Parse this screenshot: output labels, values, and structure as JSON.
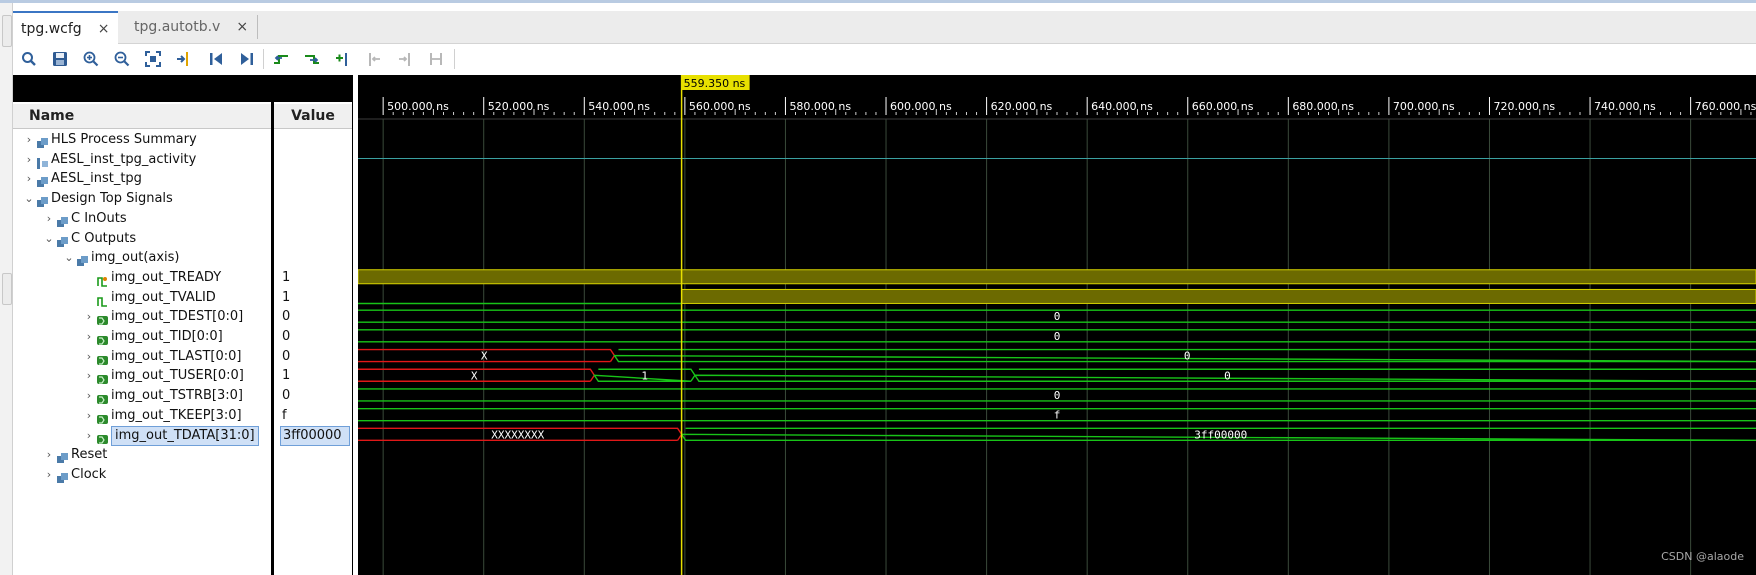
{
  "tabs": [
    {
      "label": "tpg.wcfg",
      "active": true
    },
    {
      "label": "tpg.autotb.v",
      "active": false
    }
  ],
  "tab_close_glyph": "×",
  "toolbar": [
    {
      "name": "search-icon",
      "enabled": true
    },
    {
      "name": "save-icon",
      "enabled": true
    },
    {
      "name": "zoom-in-icon",
      "enabled": true
    },
    {
      "name": "zoom-out-icon",
      "enabled": true
    },
    {
      "name": "zoom-fit-icon",
      "enabled": true
    },
    {
      "name": "go-to-cursor-icon",
      "enabled": true
    },
    {
      "name": "go-to-time-zero-icon",
      "enabled": true
    },
    {
      "name": "go-to-last-time-icon",
      "enabled": true
    },
    {
      "name": "previous-transition-icon",
      "enabled": true
    },
    {
      "name": "next-transition-icon",
      "enabled": true
    },
    {
      "name": "add-marker-icon",
      "enabled": true
    },
    {
      "name": "previous-marker-icon",
      "enabled": false
    },
    {
      "name": "next-marker-icon",
      "enabled": false
    },
    {
      "name": "swap-cursors-icon",
      "enabled": false
    }
  ],
  "columns": {
    "name": "Name",
    "value": "Value"
  },
  "signals": [
    {
      "name": "HLS Process Summary",
      "value": "",
      "indent": 0,
      "expander": "collapsed",
      "icon": "group-icon",
      "kind": "none"
    },
    {
      "name": "AESL_inst_tpg_activity",
      "value": "",
      "indent": 0,
      "expander": "collapsed",
      "icon": "activity-icon",
      "kind": "line"
    },
    {
      "name": "AESL_inst_tpg",
      "value": "",
      "indent": 0,
      "expander": "collapsed",
      "icon": "group-icon",
      "kind": "none"
    },
    {
      "name": "Design Top Signals",
      "value": "",
      "indent": 0,
      "expander": "expanded",
      "icon": "group-icon",
      "kind": "none"
    },
    {
      "name": "C InOuts",
      "value": "",
      "indent": 1,
      "expander": "collapsed",
      "icon": "group-icon",
      "kind": "none"
    },
    {
      "name": "C Outputs",
      "value": "",
      "indent": 1,
      "expander": "expanded",
      "icon": "group-icon",
      "kind": "none"
    },
    {
      "name": "img_out(axis)",
      "value": "",
      "indent": 2,
      "expander": "expanded",
      "icon": "group-icon",
      "kind": "none"
    },
    {
      "name": "img_out_TREADY",
      "value": "1",
      "indent": 3,
      "expander": "none",
      "icon": "input-bit-icon",
      "kind": "bit-high"
    },
    {
      "name": "img_out_TVALID",
      "value": "1",
      "indent": 3,
      "expander": "none",
      "icon": "output-bit-icon",
      "kind": "bit-rise"
    },
    {
      "name": "img_out_TDEST[0:0]",
      "value": "0",
      "indent": 3,
      "expander": "collapsed",
      "icon": "bus-icon",
      "kind": "bus"
    },
    {
      "name": "img_out_TID[0:0]",
      "value": "0",
      "indent": 3,
      "expander": "collapsed",
      "icon": "bus-icon",
      "kind": "bus"
    },
    {
      "name": "img_out_TLAST[0:0]",
      "value": "0",
      "indent": 3,
      "expander": "collapsed",
      "icon": "bus-icon",
      "kind": "bus"
    },
    {
      "name": "img_out_TUSER[0:0]",
      "value": "1",
      "indent": 3,
      "expander": "collapsed",
      "icon": "bus-icon",
      "kind": "bus"
    },
    {
      "name": "img_out_TSTRB[3:0]",
      "value": "0",
      "indent": 3,
      "expander": "collapsed",
      "icon": "bus-icon",
      "kind": "bus"
    },
    {
      "name": "img_out_TKEEP[3:0]",
      "value": "f",
      "indent": 3,
      "expander": "collapsed",
      "icon": "bus-icon",
      "kind": "bus"
    },
    {
      "name": "img_out_TDATA[31:0]",
      "value": "3ff00000",
      "indent": 3,
      "expander": "collapsed",
      "icon": "bus-icon",
      "kind": "bus",
      "selected": true
    },
    {
      "name": "Reset",
      "value": "",
      "indent": 1,
      "expander": "collapsed",
      "icon": "group-icon",
      "kind": "none"
    },
    {
      "name": "Clock",
      "value": "",
      "indent": 1,
      "expander": "collapsed",
      "icon": "group-icon",
      "kind": "none"
    }
  ],
  "timeline": {
    "unit": "ns",
    "tick_labels": [
      "500.000 ns",
      "520.000 ns",
      "540.000 ns",
      "560.000 ns",
      "580.000 ns",
      "600.000 ns",
      "620.000 ns",
      "640.000 ns",
      "660.000 ns",
      "680.000 ns",
      "700.000 ns",
      "720.000 ns",
      "740.000 ns",
      "760.000 ns"
    ],
    "tick_values": [
      500,
      520,
      540,
      560,
      580,
      600,
      620,
      640,
      660,
      680,
      700,
      720,
      740,
      760
    ],
    "view_start": 495,
    "view_end": 773,
    "cursor_time": 559.35,
    "cursor_label": "559.350 ns"
  },
  "waves": {
    "img_out_TDEST[0:0]": [
      {
        "from": 495,
        "to": 773,
        "label": "0",
        "state": "valid"
      }
    ],
    "img_out_TID[0:0]": [
      {
        "from": 495,
        "to": 773,
        "label": "0",
        "state": "valid"
      }
    ],
    "img_out_TLAST[0:0]": [
      {
        "from": 495,
        "to": 546,
        "label": "X",
        "state": "unknown"
      },
      {
        "from": 546,
        "to": 773,
        "label": "0",
        "state": "valid"
      }
    ],
    "img_out_TUSER[0:0]": [
      {
        "from": 495,
        "to": 542,
        "label": "X",
        "state": "unknown"
      },
      {
        "from": 542,
        "to": 562,
        "label": "1",
        "state": "valid"
      },
      {
        "from": 562,
        "to": 773,
        "label": "0",
        "state": "valid"
      }
    ],
    "img_out_TSTRB[3:0]": [
      {
        "from": 495,
        "to": 773,
        "label": "0",
        "state": "valid"
      }
    ],
    "img_out_TKEEP[3:0]": [
      {
        "from": 495,
        "to": 773,
        "label": "f",
        "state": "valid"
      }
    ],
    "img_out_TDATA[31:0]": [
      {
        "from": 495,
        "to": 559.35,
        "label": "XXXXXXXX",
        "state": "unknown"
      },
      {
        "from": 559.35,
        "to": 773,
        "label": "3ff00000",
        "state": "valid"
      }
    ],
    "img_out_TREADY": {
      "high_from": 495
    },
    "img_out_TVALID": {
      "high_from": 559.35
    }
  },
  "colors": {
    "wave_bg": "#000000",
    "grid": "#3a4a3a",
    "bus_valid": "#18c418",
    "bus_unknown": "#e01818",
    "bit_high": "#6c6a00",
    "bit_edge": "#d6d200",
    "cursor": "#e8e000",
    "tick_text": "#ffffff",
    "activity": "#3aa0a0"
  },
  "watermark": "CSDN @alaode"
}
